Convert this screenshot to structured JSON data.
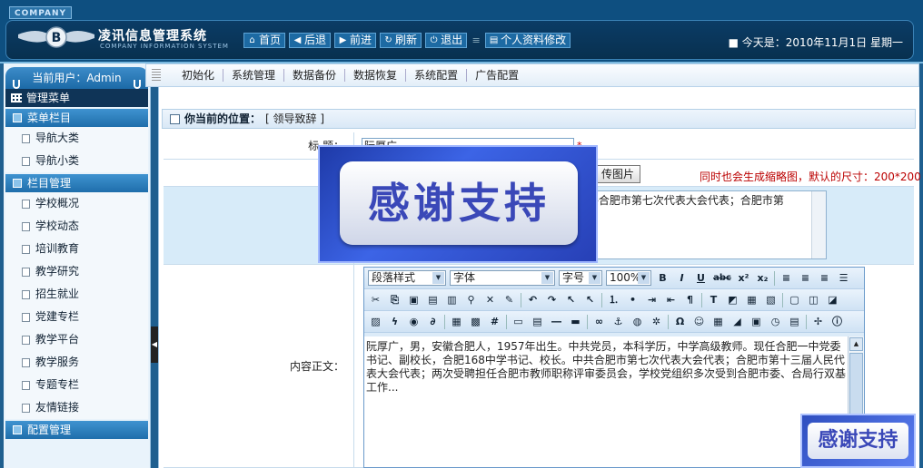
{
  "header": {
    "company": "COMPANY",
    "system_title": "凌讯信息管理系统",
    "system_subtitle": "COMPANY INFORMATION SYSTEM",
    "nav": [
      {
        "label": "首页",
        "icon": "home-icon"
      },
      {
        "label": "后退",
        "icon": "back-arrow-icon"
      },
      {
        "label": "前进",
        "icon": "forward-arrow-icon"
      },
      {
        "label": "刷新",
        "icon": "refresh-icon"
      },
      {
        "label": "退出",
        "icon": "power-icon"
      },
      {
        "label": "个人资料修改",
        "icon": "profile-icon"
      }
    ],
    "today": "■ 今天是：2010年11月1日  星期一"
  },
  "sidebar": {
    "current_user": "当前用户：Admin",
    "menu_title": "管理菜单",
    "groups": [
      {
        "title": "菜单栏目",
        "items": [
          "导航大类",
          "导航小类"
        ]
      },
      {
        "title": "栏目管理",
        "items": [
          "学校概况",
          "学校动态",
          "培训教育",
          "教学研究",
          "招生就业",
          "党建专栏",
          "教学平台",
          "教学服务",
          "专题专栏",
          "友情链接"
        ]
      },
      {
        "title": "配置管理",
        "items": []
      }
    ]
  },
  "subnav": [
    "初始化",
    "系统管理",
    "数据备份",
    "数据恢复",
    "系统配置",
    "广告配置"
  ],
  "location": {
    "label": "你当前的位置：",
    "value": "[ 领导致辞 ]"
  },
  "form": {
    "title_label": "标  题：",
    "title_value": "阮厚广",
    "required_mark": "*",
    "upload_label": "上传",
    "upload_button": "传图片",
    "upload_hint": "同时也会生成缩略图，默认的尺寸：200*200",
    "summary_label": "内容",
    "summary_text": "员，本科学历，中学高级教师。现任合肥一          中共合肥市第七次代表大会代表；合肥市第",
    "content_label": "内容正文：",
    "content_text": "阮厚广，男，安徽合肥人，1957年出生。中共党员，本科学历，中学高级教师。现任合肥一中党委书记、副校长，合肥168中学书记、校长。中共合肥市第七次代表大会代表；合肥市第十三届人民代表大会代表；两次受聘担任合肥市教师职称评审委员会，学校党组织多次受到合肥市委、合局行双基工作..."
  },
  "editor": {
    "paragraph_style": "段落样式",
    "font": "字体",
    "font_size": "字号",
    "zoom": "100%",
    "format_buttons": [
      "B",
      "I",
      "U",
      "abc",
      "x²",
      "x₂"
    ]
  },
  "watermark": {
    "text": "感谢支持"
  }
}
